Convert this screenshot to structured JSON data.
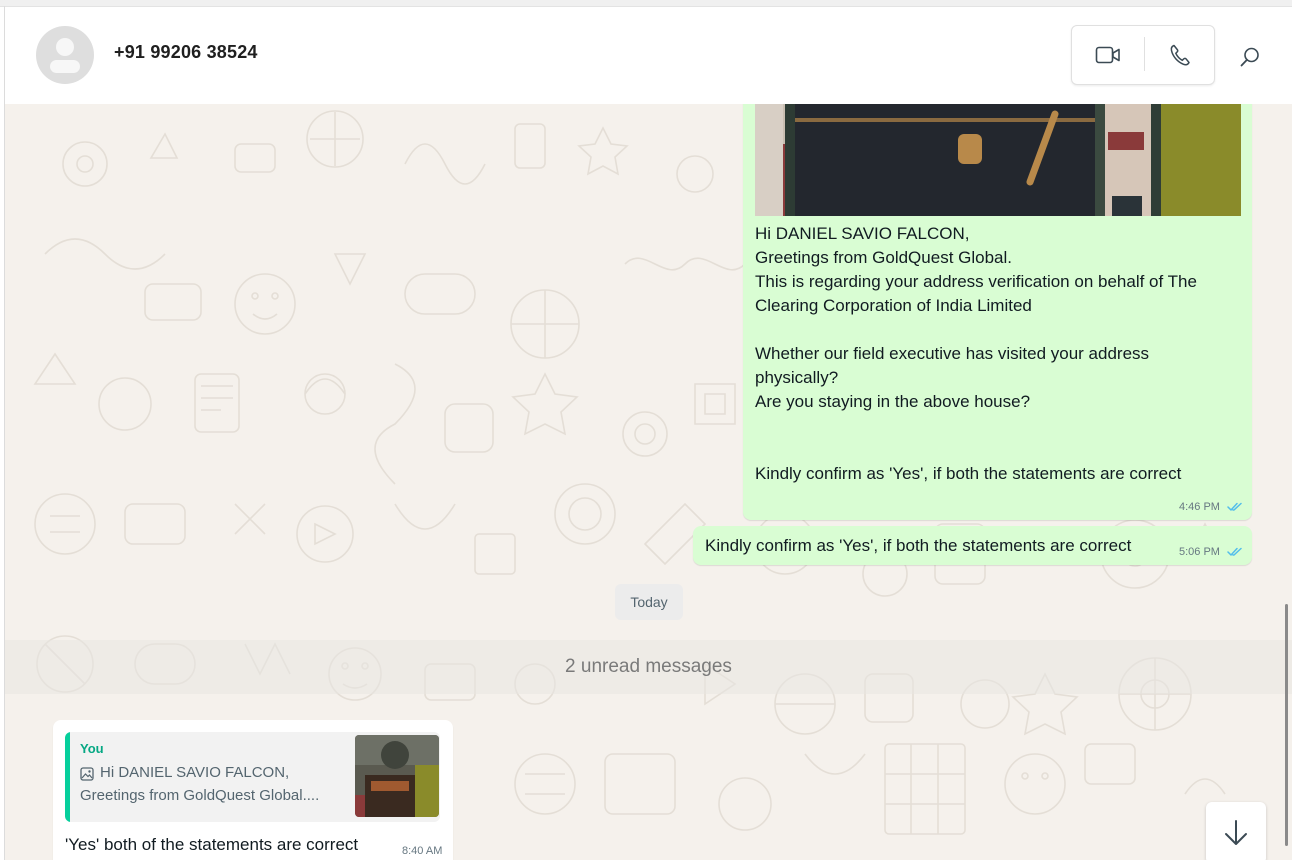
{
  "header": {
    "contact_name": "+91 99206 38524",
    "icons": [
      "video-call-icon",
      "voice-call-icon",
      "search-icon"
    ]
  },
  "messages": {
    "main_text_lines": [
      "Hi DANIEL SAVIO FALCON,",
      "Greetings from GoldQuest Global.",
      "This is regarding your address verification on behalf of The",
      "Clearing Corporation of India Limited",
      "",
      "Whether our field executive has visited your address",
      "physically?",
      "Are you staying in the above house?",
      "",
      "",
      "Kindly confirm as 'Yes', if both the statements are correct"
    ],
    "main_time": "4:46 PM",
    "second_text": "Kindly confirm as 'Yes', if both the statements are correct",
    "second_time": "5:06 PM",
    "date_divider": "Today",
    "unread_banner": "2 unread messages",
    "reply": {
      "quoted_author": "You",
      "quoted_line1": "Hi DANIEL SAVIO FALCON,",
      "quoted_line2": "Greetings from GoldQuest Global....",
      "text": "'Yes' both of the statements are correct",
      "time": "8:40 AM"
    }
  },
  "colors": {
    "outgoing_bubble": "#d9fdd3",
    "incoming_bubble": "#ffffff",
    "chat_background": "#f5f1ec",
    "read_ticks": "#53bdeb",
    "quote_accent": "#06cf9c"
  }
}
